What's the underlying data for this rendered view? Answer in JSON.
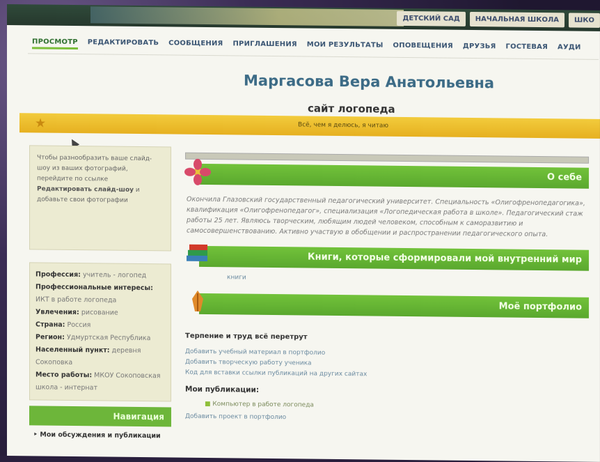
{
  "school_tabs": [
    "ДЕТСКИЙ САД",
    "НАЧАЛЬНАЯ ШКОЛА",
    "ШКО"
  ],
  "nav": {
    "items": [
      "ПРОСМОТР",
      "РЕДАКТИРОВАТЬ",
      "СООБЩЕНИЯ",
      "ПРИГЛАШЕНИЯ",
      "МОИ РЕЗУЛЬТАТЫ",
      "ОПОВЕЩЕНИЯ",
      "ДРУЗЬЯ",
      "ГОСТЕВАЯ",
      "АУДИ"
    ],
    "active": "ПРОСМОТР"
  },
  "page": {
    "name": "Маргасова Вера Анатольевна",
    "subtitle": "сайт логопеда",
    "banner": "Всё, чем я делюсь, я читаю"
  },
  "sidebar": {
    "tip_text": "Чтобы разнообразить ваше слайд-шоу из ваших фотографий, перейдите по ссылке",
    "tip_link": "Редактировать слайд-шоу",
    "tip_tail": "и добавьте свои фотографии",
    "profile": [
      {
        "key": "Профессия:",
        "value": "учитель - логопед"
      },
      {
        "key": "Профессиональные интересы:",
        "value": "ИКТ в работе логопеда"
      },
      {
        "key": "Увлечения:",
        "value": "рисование"
      },
      {
        "key": "Страна:",
        "value": "Россия"
      },
      {
        "key": "Регион:",
        "value": "Удмуртская Республика"
      },
      {
        "key": "Населенный пункт:",
        "value": "деревня Сокоповка"
      },
      {
        "key": "Место работы:",
        "value": "МКОУ Сокоповская школа - интернат"
      }
    ],
    "nav_head": "Навигация",
    "nav_item": "Мои обсуждения и публикации"
  },
  "main": {
    "about_head": "О себе",
    "about_text": "Окончила Глазовский государственный педагогический университет. Специальность «Олигофренопедагогика», квалификация «Олигофренопедагог», специализация «Логопедическая работа в школе». Педагогический стаж работы 25 лет. Являюсь творческим, любящим людей человеком, способным к саморазвитию и самосовершенствованию. Активно участвую в обобщении и распространении педагогического опыта.",
    "books_head": "Книги, которые сформировали мой внутренний мир",
    "books_link": "книги",
    "portfolio_head": "Моё портфолио",
    "portfolio_title": "Терпение и труд всё перетрут",
    "portfolio_links": [
      "Добавить учебный материал в портфолио",
      "Добавить творческую работу ученика",
      "Код для вставки ссылки публикаций на других сайтах"
    ],
    "pub_title": "Мои публикации:",
    "pub_item": "Компьютер в работе логопеда",
    "add_link": "Добавить проект в портфолио"
  }
}
